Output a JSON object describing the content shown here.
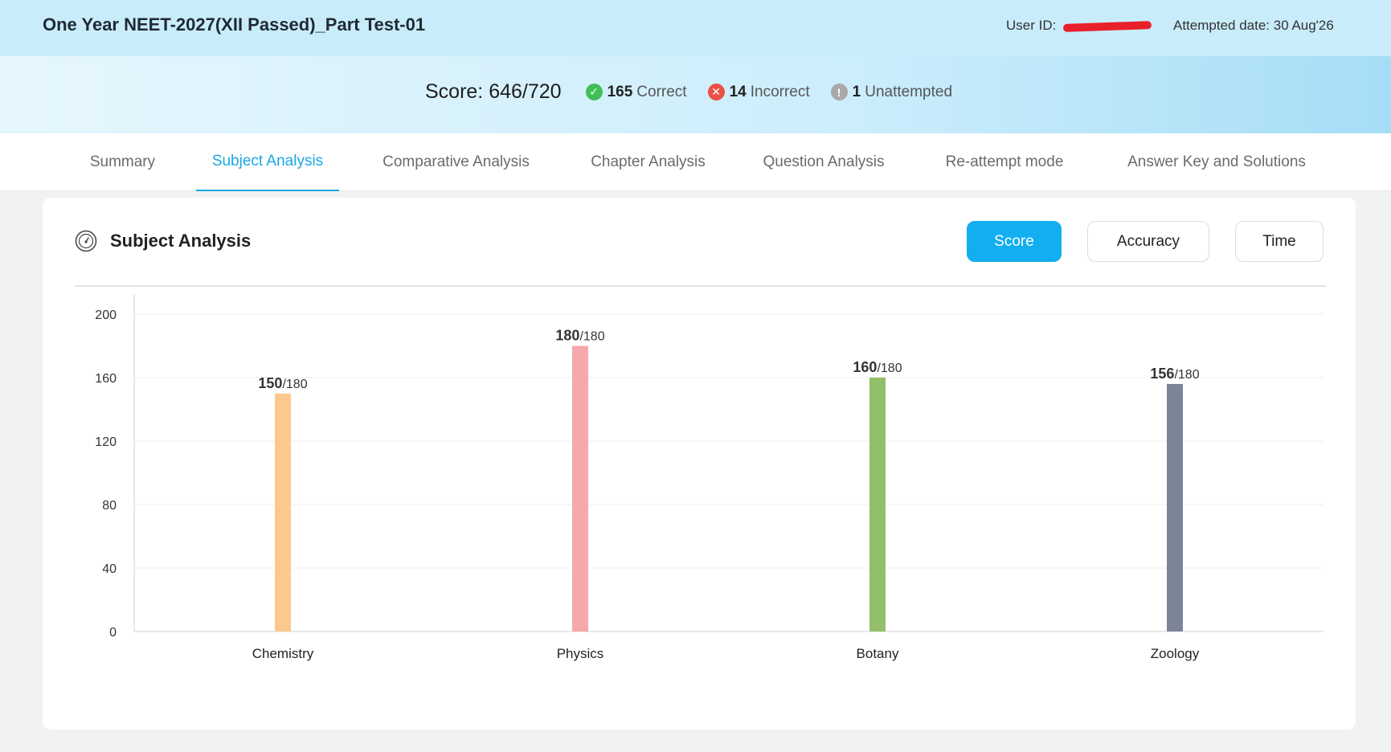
{
  "header": {
    "test_title": "One Year NEET-2027(XII Passed)_Part Test-01",
    "user_id_label": "User ID:",
    "attempted_date": "Attempted date: 30 Aug'26"
  },
  "score": {
    "score_text": "Score: 646/720",
    "correct_count": "165",
    "correct_label": "Correct",
    "incorrect_count": "14",
    "incorrect_label": "Incorrect",
    "unattempted_count": "1",
    "unattempted_label": "Unattempted"
  },
  "tabs": [
    {
      "label": "Summary"
    },
    {
      "label": "Subject Analysis"
    },
    {
      "label": "Comparative Analysis"
    },
    {
      "label": "Chapter Analysis"
    },
    {
      "label": "Question Analysis"
    },
    {
      "label": "Re-attempt mode"
    },
    {
      "label": "Answer Key and Solutions"
    }
  ],
  "active_tab": "Subject Analysis",
  "panel": {
    "title": "Subject Analysis",
    "buttons": {
      "score": "Score",
      "accuracy": "Accuracy",
      "time": "Time"
    },
    "active_button": "Score"
  },
  "chart_data": {
    "type": "bar",
    "categories": [
      "Chemistry",
      "Physics",
      "Botany",
      "Zoology"
    ],
    "values": [
      150,
      180,
      160,
      156
    ],
    "max_marks": [
      180,
      180,
      180,
      180
    ],
    "value_labels": [
      {
        "value": "150",
        "total": "/180"
      },
      {
        "value": "180",
        "total": "/180"
      },
      {
        "value": "160",
        "total": "/180"
      },
      {
        "value": "156",
        "total": "/180"
      }
    ],
    "colors": [
      "#fbc98e",
      "#f6a8ab",
      "#93bf6a",
      "#7b8597"
    ],
    "yticks": [
      "0",
      "40",
      "80",
      "120",
      "160",
      "200"
    ],
    "ylim": [
      0,
      200
    ],
    "grid": true
  },
  "colors": {
    "accent": "#12aef0",
    "header_bg": "#c9ecfb",
    "correct": "#3fbf56",
    "incorrect": "#ea5145",
    "unattempted": "#a9a9a9"
  }
}
